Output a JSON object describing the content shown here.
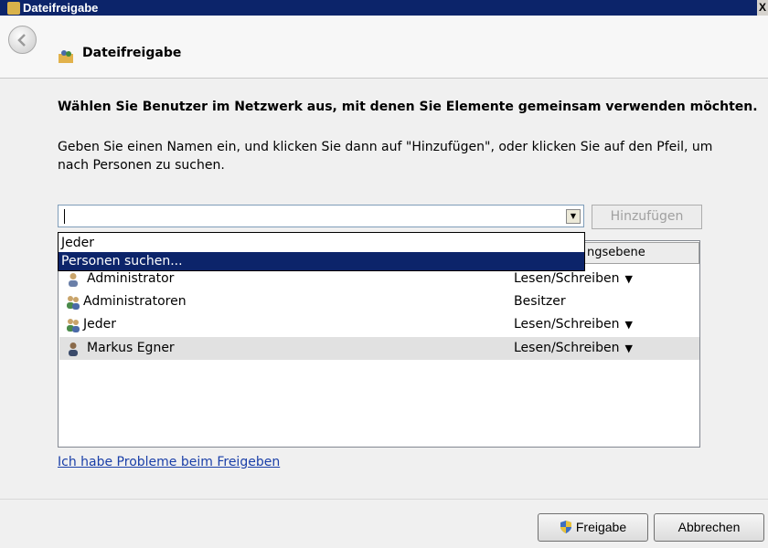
{
  "window": {
    "title": "Dateifreigabe",
    "close_label": "X"
  },
  "header": {
    "title": "Dateifreigabe"
  },
  "instruction": "Wählen Sie Benutzer im Netzwerk aus, mit denen Sie Elemente gemeinsam verwenden möchten.",
  "description": "Geben Sie einen Namen ein, und klicken Sie dann auf \"Hinzufügen\", oder klicken Sie auf den Pfeil, um nach Personen zu suchen.",
  "name_input": {
    "value": ""
  },
  "add_button": {
    "label": "Hinzufügen",
    "enabled": false
  },
  "dropdown": {
    "items": [
      {
        "label": "Jeder",
        "highlighted": false
      },
      {
        "label": "Personen suchen...",
        "highlighted": true
      }
    ]
  },
  "list": {
    "column_header": "ngsebene",
    "rows": [
      {
        "name": "Administrator",
        "permission": "Lesen/Schreiben",
        "has_menu": true,
        "icon": "user-icon"
      },
      {
        "name": "Administratoren",
        "permission": "Besitzer",
        "has_menu": false,
        "icon": "group-icon"
      },
      {
        "name": "Jeder",
        "permission": "Lesen/Schreiben",
        "has_menu": true,
        "icon": "group-icon"
      },
      {
        "name": "Markus Egner",
        "permission": "Lesen/Schreiben",
        "has_menu": true,
        "icon": "user-icon",
        "selected": true
      }
    ]
  },
  "help_link": "Ich habe Probleme beim Freigeben",
  "footer": {
    "share_label": "Freigabe",
    "cancel_label": "Abbrechen"
  },
  "colors": {
    "titlebar": "#0c246a",
    "highlight": "#0c246a",
    "link": "#1a3fa8"
  }
}
